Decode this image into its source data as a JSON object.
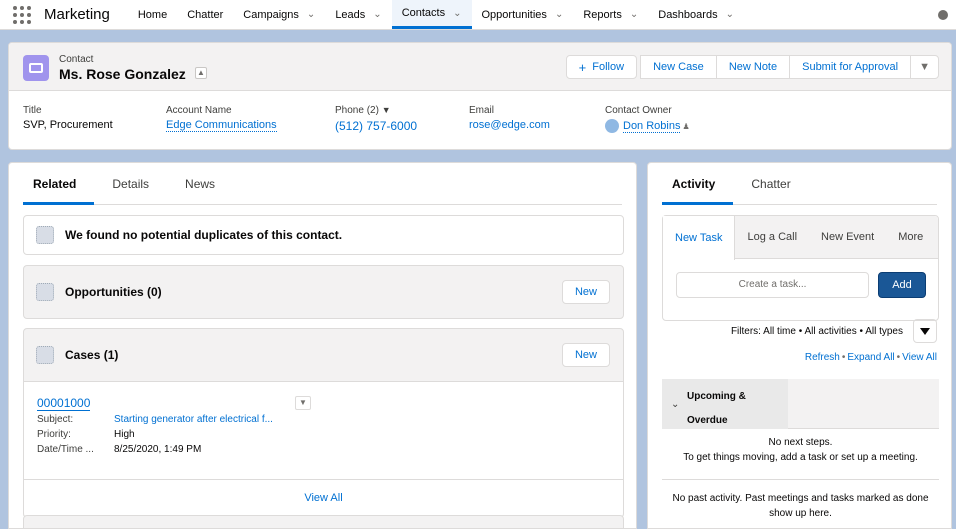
{
  "app": {
    "name": "Marketing"
  },
  "nav": {
    "items": [
      {
        "label": "Home",
        "dropdown": false,
        "active": false
      },
      {
        "label": "Chatter",
        "dropdown": false,
        "active": false
      },
      {
        "label": "Campaigns",
        "dropdown": true,
        "active": false
      },
      {
        "label": "Leads",
        "dropdown": true,
        "active": false
      },
      {
        "label": "Contacts",
        "dropdown": true,
        "active": true
      },
      {
        "label": "Opportunities",
        "dropdown": true,
        "active": false
      },
      {
        "label": "Reports",
        "dropdown": true,
        "active": false
      },
      {
        "label": "Dashboards",
        "dropdown": true,
        "active": false
      }
    ]
  },
  "record": {
    "object_label": "Contact",
    "name": "Ms. Rose Gonzalez",
    "actions": {
      "follow": "Follow",
      "new_case": "New Case",
      "new_note": "New Note",
      "submit": "Submit for Approval"
    },
    "fields": {
      "title_label": "Title",
      "title_value": "SVP, Procurement",
      "account_label": "Account Name",
      "account_value": "Edge Communications",
      "phone_label": "Phone (2)",
      "phone_value": "(512) 757-6000",
      "email_label": "Email",
      "email_value": "rose@edge.com",
      "owner_label": "Contact Owner",
      "owner_value": "Don Robins"
    }
  },
  "left": {
    "tabs": [
      "Related",
      "Details",
      "News"
    ],
    "duplicates": "We found no potential duplicates of this contact.",
    "opportunities": {
      "title": "Opportunities (0)",
      "new_label": "New"
    },
    "cases": {
      "title": "Cases (1)",
      "new_label": "New",
      "case_number": "00001000",
      "subject_label": "Subject:",
      "subject_value": "Starting generator after electrical f...",
      "priority_label": "Priority:",
      "priority_value": "High",
      "date_label": "Date/Time ...",
      "date_value": "8/25/2020, 1:49 PM",
      "view_all": "View All"
    }
  },
  "right": {
    "tabs": [
      "Activity",
      "Chatter"
    ],
    "composer_tabs": [
      "New Task",
      "Log a Call",
      "New Event",
      "More"
    ],
    "task_placeholder": "Create a task...",
    "add_label": "Add",
    "filters": "Filters: All time • All activities • All types",
    "links": {
      "refresh": "Refresh",
      "expand_all": "Expand All",
      "view_all": "View All"
    },
    "upcoming_line1": "Upcoming &",
    "upcoming_line2": "Overdue",
    "no_steps_line1": "No next steps.",
    "no_steps_line2": "To get things moving, add a task or set up a meeting.",
    "no_past_line1": "No past activity. Past meetings and tasks marked as done",
    "no_past_line2": "show up here."
  },
  "colors": {
    "brand_blue": "#0070d2",
    "add_button": "#1a5796",
    "contact_icon": "#a094ed",
    "background": "#b0c4df"
  }
}
